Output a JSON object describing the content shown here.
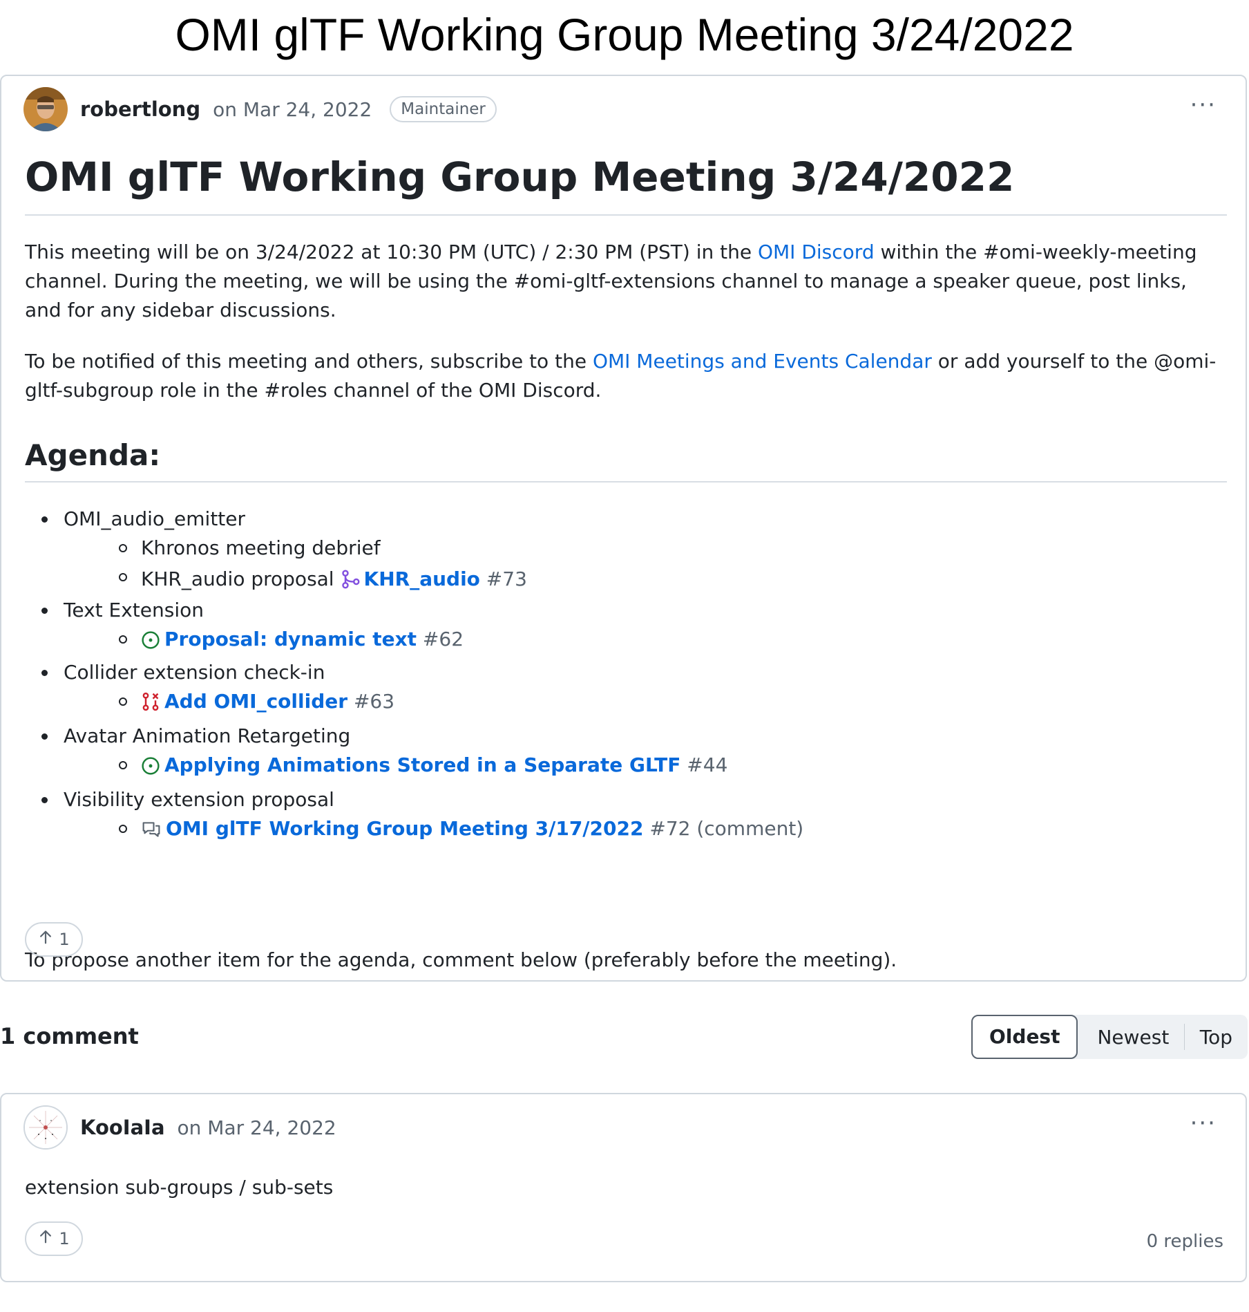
{
  "page_title": "OMI glTF Working Group Meeting 3/24/2022",
  "post": {
    "author": "robertlong",
    "date": "on Mar 24, 2022",
    "badge": "Maintainer",
    "more": "···",
    "title": "OMI glTF Working Group Meeting 3/24/2022",
    "p1": {
      "a": "This meeting will be on 3/24/2022 at 10:30 PM (UTC) / 2:30 PM (PST) in the ",
      "link": "OMI Discord",
      "b": " within the #omi-weekly-meeting channel. During the meeting, we will be using the #omi-gltf-extensions channel to manage a speaker queue, post links, and for any sidebar discussions."
    },
    "p2": {
      "a": "To be notified of this meeting and others, subscribe to the ",
      "link": "OMI Meetings and Events Calendar",
      "b": " or add yourself to the @omi-gltf-subgroup role in the #roles channel of the OMI Discord."
    },
    "agenda_heading": "Agenda:",
    "agenda": [
      {
        "label": "OMI_audio_emitter",
        "children": [
          {
            "text": "Khronos meeting debrief"
          },
          {
            "text": "KHR_audio proposal ",
            "icon": "pr-merged-icon",
            "ref": "KHR_audio",
            "num": " #73"
          }
        ]
      },
      {
        "label": "Text Extension",
        "children": [
          {
            "icon": "issue-open-icon",
            "ref": "Proposal: dynamic text",
            "num": " #62"
          }
        ]
      },
      {
        "label": "Collider extension check-in",
        "children": [
          {
            "icon": "pr-closed-icon",
            "ref": "Add OMI_collider",
            "num": " #63"
          }
        ]
      },
      {
        "label": "Avatar Animation Retargeting",
        "children": [
          {
            "icon": "issue-open-icon",
            "ref": "Applying Animations Stored in a Separate GLTF",
            "num": " #44"
          }
        ]
      },
      {
        "label": "Visibility extension proposal",
        "children": [
          {
            "icon": "discussion-icon",
            "ref": "OMI glTF Working Group Meeting 3/17/2022",
            "num": " #72 (comment)"
          }
        ]
      }
    ],
    "footer_text": "To propose another item for the agenda, comment below (preferably before the meeting).",
    "upvotes": "1"
  },
  "comments_header": {
    "count_label": "1 comment",
    "sort_options": [
      "Oldest",
      "Newest",
      "Top"
    ],
    "active_sort": "Oldest"
  },
  "comment": {
    "author": "KooIaIa",
    "date": "on Mar 24, 2022",
    "more": "···",
    "body": "extension sub-groups / sub-sets",
    "upvotes": "1",
    "replies": "0 replies"
  },
  "colors": {
    "link": "#0969da",
    "issue_open": "#1a7f37",
    "pr_merged": "#8250df",
    "pr_closed": "#cf222e",
    "muted": "#59636e",
    "border": "#d0d7de"
  }
}
